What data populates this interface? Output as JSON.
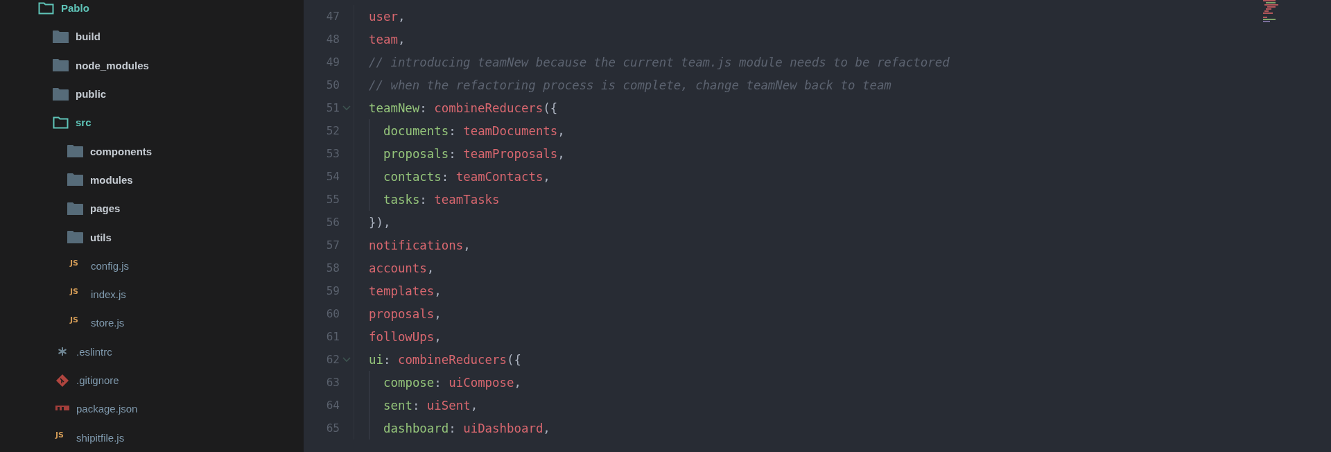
{
  "sidebar": {
    "tree": [
      {
        "name": "Pablo",
        "kind": "folder",
        "expanded": true,
        "children": [
          {
            "name": "build",
            "kind": "folder",
            "expanded": false
          },
          {
            "name": "node_modules",
            "kind": "folder",
            "expanded": false
          },
          {
            "name": "public",
            "kind": "folder",
            "expanded": false
          },
          {
            "name": "src",
            "kind": "folder",
            "expanded": true,
            "children": [
              {
                "name": "components",
                "kind": "folder",
                "expanded": false
              },
              {
                "name": "modules",
                "kind": "folder",
                "expanded": false
              },
              {
                "name": "pages",
                "kind": "folder",
                "expanded": false
              },
              {
                "name": "utils",
                "kind": "folder",
                "expanded": false
              },
              {
                "name": "config.js",
                "kind": "js",
                "icon_text": "JS"
              },
              {
                "name": "index.js",
                "kind": "js",
                "icon_text": "JS"
              },
              {
                "name": "store.js",
                "kind": "js",
                "icon_text": "JS"
              }
            ]
          },
          {
            "name": ".eslintrc",
            "kind": "config"
          },
          {
            "name": ".gitignore",
            "kind": "git"
          },
          {
            "name": "package.json",
            "kind": "npm"
          },
          {
            "name": "shipitfile.js",
            "kind": "js",
            "icon_text": "JS"
          }
        ]
      }
    ]
  },
  "editor": {
    "lines": [
      {
        "number": "47",
        "tokens": [
          {
            "kind": "ident",
            "text": "user"
          },
          {
            "kind": "punct",
            "text": ","
          }
        ]
      },
      {
        "number": "48",
        "tokens": [
          {
            "kind": "ident",
            "text": "team"
          },
          {
            "kind": "punct",
            "text": ","
          }
        ]
      },
      {
        "number": "49",
        "tokens": [
          {
            "kind": "comment",
            "text": "// introducing teamNew because the current team.js module needs to be refactored"
          }
        ]
      },
      {
        "number": "50",
        "tokens": [
          {
            "kind": "comment",
            "text": "// when the refactoring process is complete, change teamNew back to team"
          }
        ]
      },
      {
        "number": "51",
        "foldable": true,
        "tokens": [
          {
            "kind": "key",
            "text": "teamNew"
          },
          {
            "kind": "punct",
            "text": ": "
          },
          {
            "kind": "ident",
            "text": "combineReducers"
          },
          {
            "kind": "punct",
            "text": "({"
          }
        ],
        "children": [
          {
            "number": "52",
            "tokens": [
              {
                "kind": "key",
                "text": "documents"
              },
              {
                "kind": "punct",
                "text": ": "
              },
              {
                "kind": "ident",
                "text": "teamDocuments"
              },
              {
                "kind": "punct",
                "text": ","
              }
            ]
          },
          {
            "number": "53",
            "tokens": [
              {
                "kind": "key",
                "text": "proposals"
              },
              {
                "kind": "punct",
                "text": ": "
              },
              {
                "kind": "ident",
                "text": "teamProposals"
              },
              {
                "kind": "punct",
                "text": ","
              }
            ]
          },
          {
            "number": "54",
            "tokens": [
              {
                "kind": "key",
                "text": "contacts"
              },
              {
                "kind": "punct",
                "text": ": "
              },
              {
                "kind": "ident",
                "text": "teamContacts"
              },
              {
                "kind": "punct",
                "text": ","
              }
            ]
          },
          {
            "number": "55",
            "tokens": [
              {
                "kind": "key",
                "text": "tasks"
              },
              {
                "kind": "punct",
                "text": ": "
              },
              {
                "kind": "ident",
                "text": "teamTasks"
              }
            ]
          }
        ]
      },
      {
        "number": "56",
        "tokens": [
          {
            "kind": "punct",
            "text": "}),"
          }
        ]
      },
      {
        "number": "57",
        "tokens": [
          {
            "kind": "ident",
            "text": "notifications"
          },
          {
            "kind": "punct",
            "text": ","
          }
        ]
      },
      {
        "number": "58",
        "tokens": [
          {
            "kind": "ident",
            "text": "accounts"
          },
          {
            "kind": "punct",
            "text": ","
          }
        ]
      },
      {
        "number": "59",
        "tokens": [
          {
            "kind": "ident",
            "text": "templates"
          },
          {
            "kind": "punct",
            "text": ","
          }
        ]
      },
      {
        "number": "60",
        "tokens": [
          {
            "kind": "ident",
            "text": "proposals"
          },
          {
            "kind": "punct",
            "text": ","
          }
        ]
      },
      {
        "number": "61",
        "tokens": [
          {
            "kind": "ident",
            "text": "followUps"
          },
          {
            "kind": "punct",
            "text": ","
          }
        ]
      },
      {
        "number": "62",
        "foldable": true,
        "tokens": [
          {
            "kind": "key",
            "text": "ui"
          },
          {
            "kind": "punct",
            "text": ": "
          },
          {
            "kind": "ident",
            "text": "combineReducers"
          },
          {
            "kind": "punct",
            "text": "({"
          }
        ],
        "children": [
          {
            "number": "63",
            "tokens": [
              {
                "kind": "key",
                "text": "compose"
              },
              {
                "kind": "punct",
                "text": ": "
              },
              {
                "kind": "ident",
                "text": "uiCompose"
              },
              {
                "kind": "punct",
                "text": ","
              }
            ]
          },
          {
            "number": "64",
            "tokens": [
              {
                "kind": "key",
                "text": "sent"
              },
              {
                "kind": "punct",
                "text": ": "
              },
              {
                "kind": "ident",
                "text": "uiSent"
              },
              {
                "kind": "punct",
                "text": ","
              }
            ]
          },
          {
            "number": "65",
            "tokens": [
              {
                "kind": "key",
                "text": "dashboard"
              },
              {
                "kind": "punct",
                "text": ": "
              },
              {
                "kind": "ident",
                "text": "uiDashboard"
              },
              {
                "kind": "punct",
                "text": ","
              }
            ]
          }
        ]
      }
    ]
  }
}
